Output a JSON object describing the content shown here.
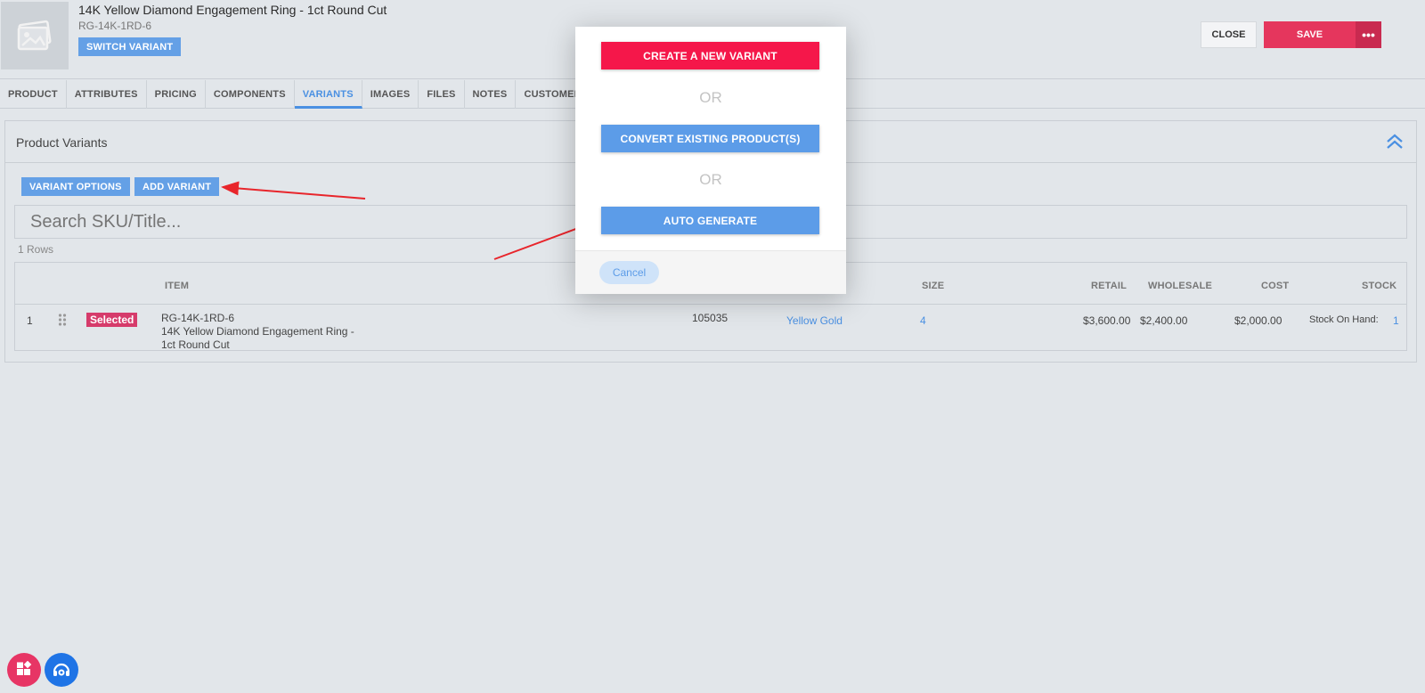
{
  "header": {
    "product_title": "14K Yellow Diamond Engagement Ring - 1ct Round Cut",
    "product_sku": "RG-14K-1RD-6",
    "switch_variant": "SWITCH VARIANT",
    "close": "CLOSE",
    "save": "SAVE",
    "more": "•••"
  },
  "tabs": [
    "PRODUCT",
    "ATTRIBUTES",
    "PRICING",
    "COMPONENTS",
    "VARIANTS",
    "IMAGES",
    "FILES",
    "NOTES",
    "CUSTOMERS"
  ],
  "active_tab": "VARIANTS",
  "panel": {
    "title": "Product Variants",
    "variant_options": "VARIANT OPTIONS",
    "add_variant": "ADD VARIANT",
    "search_placeholder": "Search SKU/Title...",
    "rows_count": "1 Rows"
  },
  "table": {
    "headers": {
      "item": "ITEM",
      "size": "SIZE",
      "retail": "RETAIL",
      "wholesale": "WHOLESALE",
      "cost": "COST",
      "stock": "STOCK"
    },
    "rows": [
      {
        "index": "1",
        "badge": "Selected",
        "sku": "RG-14K-1RD-6",
        "title_line1": "14K Yellow Diamond Engagement Ring -",
        "title_line2": "1ct Round Cut",
        "code": "105035",
        "metal": "Yellow Gold",
        "size": "4",
        "retail": "$3,600.00",
        "wholesale": "$2,400.00",
        "cost": "$2,000.00",
        "stock_label": "Stock On Hand:",
        "stock_value": "1"
      }
    ]
  },
  "modal": {
    "create_new": "CREATE A NEW VARIANT",
    "or": "OR",
    "convert_existing": "CONVERT EXISTING PRODUCT(S)",
    "auto_generate": "AUTO GENERATE",
    "cancel": "Cancel"
  },
  "colors": {
    "primary_blue": "#64a0e6",
    "save_red": "#e5365d",
    "modal_red": "#f5174a",
    "annotation_red": "#e8252b"
  }
}
